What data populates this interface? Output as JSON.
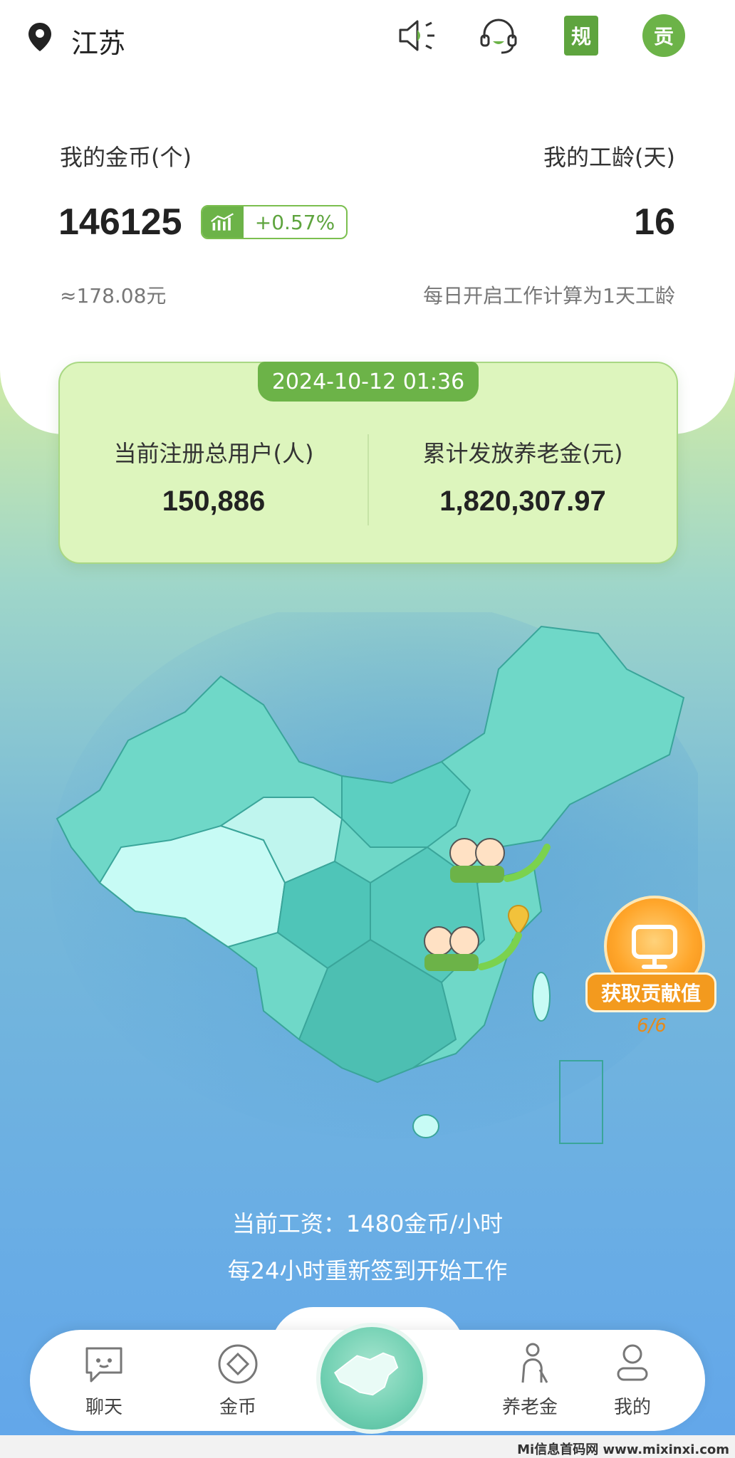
{
  "header": {
    "location": "江苏",
    "icons": [
      "location-pin-icon",
      "speaker-icon",
      "headset-icon",
      "rules-badge-icon",
      "contribution-badge-icon"
    ],
    "rules_badge": "规",
    "contribution_badge": "贡"
  },
  "account": {
    "coins_label": "我的金币(个)",
    "coins_value": "146125",
    "coins_trend": "+0.57%",
    "coins_rmb": "≈178.08元",
    "seniority_label": "我的工龄(天)",
    "seniority_value": "16",
    "seniority_note": "每日开启工作计算为1天工龄"
  },
  "stats": {
    "timestamp": "2024-10-12 01:36",
    "users_label": "当前注册总用户(人)",
    "users_value": "150,886",
    "pension_label": "累计发放养老金(元)",
    "pension_value": "1,820,307.97"
  },
  "contribution": {
    "button_label": "获取贡献值",
    "count": "6/6"
  },
  "wage": {
    "current": "当前工资：1480金币/小时",
    "note": "每24小时重新签到开始工作"
  },
  "nav": {
    "items": [
      {
        "label": "聊天",
        "icon": "chat-bubble-icon"
      },
      {
        "label": "金币",
        "icon": "coin-icon"
      },
      {
        "label": "",
        "icon": "map-home-icon"
      },
      {
        "label": "养老金",
        "icon": "elder-icon"
      },
      {
        "label": "我的",
        "icon": "profile-icon"
      }
    ]
  },
  "colors": {
    "accent_green": "#6cb348",
    "map_teal": "#6fd8c8",
    "orange": "#f39a1e"
  },
  "watermark": "Mi信息首码网 www.mixinxi.com"
}
